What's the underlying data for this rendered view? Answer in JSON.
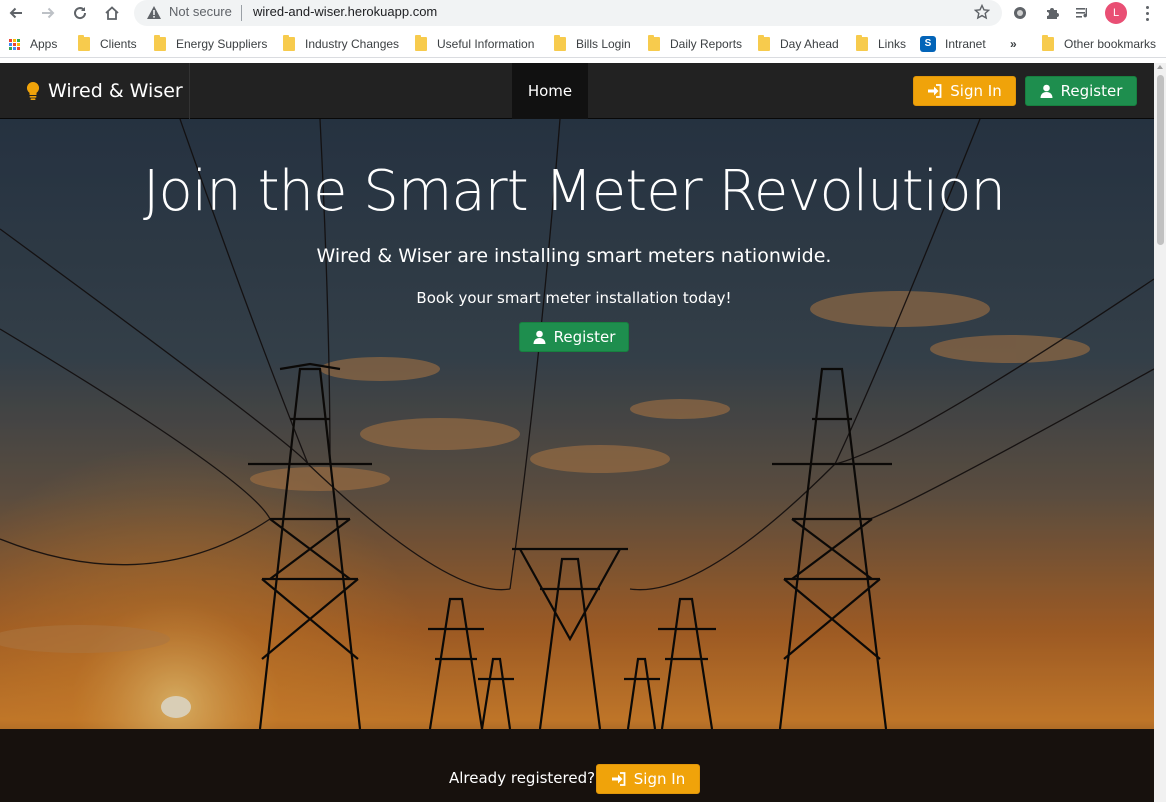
{
  "browser": {
    "security_label": "Not secure",
    "url": "wired-and-wiser.herokuapp.com",
    "profile_initial": "L",
    "overflow_chevron": "»",
    "bookmarks": [
      {
        "label": "Apps",
        "icon": "apps-grid-icon"
      },
      {
        "label": "Clients",
        "icon": "folder-icon"
      },
      {
        "label": "Energy Suppliers",
        "icon": "folder-icon"
      },
      {
        "label": "Industry Changes",
        "icon": "folder-icon"
      },
      {
        "label": "Useful Information",
        "icon": "folder-icon"
      },
      {
        "label": "Bills Login",
        "icon": "folder-icon"
      },
      {
        "label": "Daily Reports",
        "icon": "folder-icon"
      },
      {
        "label": "Day Ahead",
        "icon": "folder-icon"
      },
      {
        "label": "Links",
        "icon": "folder-icon"
      },
      {
        "label": "Intranet",
        "icon": "sharepoint-icon"
      },
      {
        "label": "Other bookmarks",
        "icon": "folder-icon"
      }
    ]
  },
  "navbar": {
    "brand": "Wired & Wiser",
    "brand_icon": "lightbulb-icon",
    "home_label": "Home",
    "sign_in_label": "Sign In",
    "register_label": "Register"
  },
  "hero": {
    "title": "Join the Smart Meter Revolution",
    "subtitle": "Wired & Wiser are installing smart meters nationwide.",
    "book_text": "Book your smart meter installation today!",
    "register_label": "Register",
    "already_text": "Already registered?",
    "sign_in_label": "Sign In"
  },
  "colors": {
    "navbar_bg": "#222222",
    "sign_in": "#f0a30a",
    "register": "#1e8e4e"
  }
}
